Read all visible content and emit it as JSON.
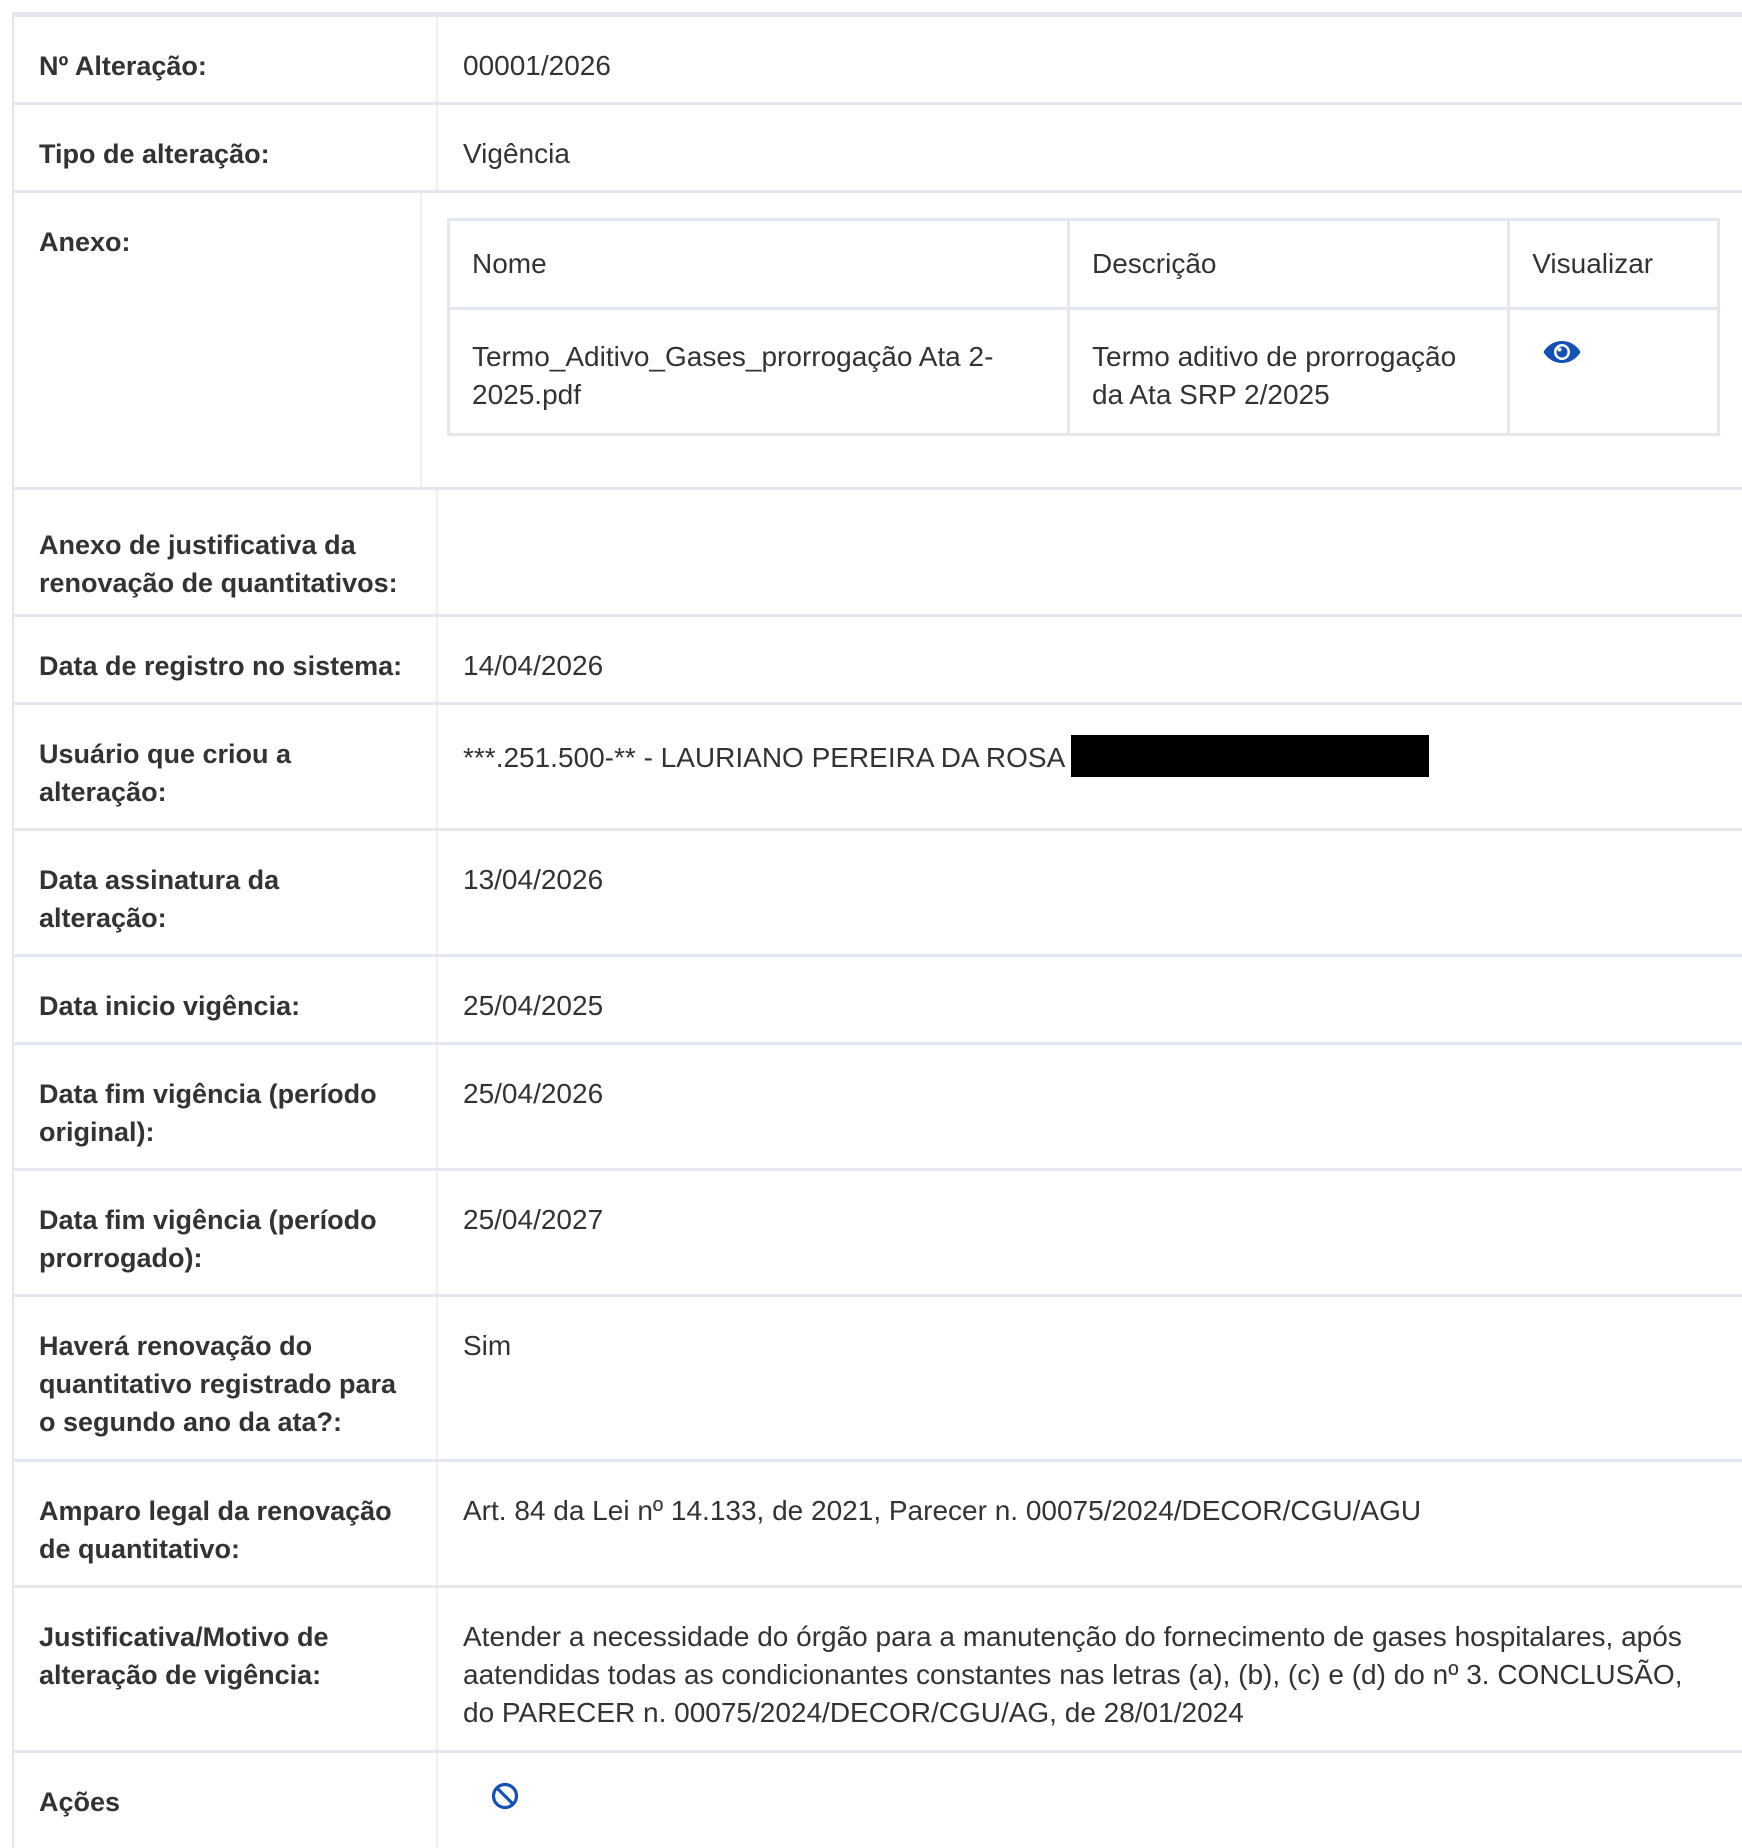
{
  "fields": {
    "numero_alteracao": {
      "label": "Nº Alteração:",
      "value": "00001/2026"
    },
    "tipo_alteracao": {
      "label": "Tipo de alteração:",
      "value": "Vigência"
    },
    "anexo": {
      "label": "Anexo:",
      "columns": [
        "Nome",
        "Descrição",
        "Visualizar"
      ],
      "rows": [
        {
          "nome": "Termo_Aditivo_Gases_prorrogação Ata 2-2025.pdf",
          "descricao": "Termo aditivo de prorrogação da Ata SRP 2/2025",
          "visualizar_icon": "eye-icon"
        }
      ]
    },
    "anexo_justificativa": {
      "label": "Anexo de justificativa da renovação de quantitativos:",
      "value": ""
    },
    "data_registro": {
      "label": "Data de registro no sistema:",
      "value": "14/04/2026"
    },
    "usuario": {
      "label": "Usuário que criou a alteração:",
      "value": "***.251.500-** - LAURIANO PEREIRA DA ROSA"
    },
    "data_assinatura": {
      "label": "Data assinatura da alteração:",
      "value": "13/04/2026"
    },
    "data_inicio_vigencia": {
      "label": "Data inicio vigência:",
      "value": "25/04/2025"
    },
    "data_fim_original": {
      "label": "Data fim vigência (período original):",
      "value": "25/04/2026"
    },
    "data_fim_prorrogado": {
      "label": "Data fim vigência (período prorrogado):",
      "value": "25/04/2027"
    },
    "renovacao_quantitativo": {
      "label": "Haverá renovação do quantitativo registrado para o segundo ano da ata?:",
      "value": "Sim"
    },
    "amparo_legal": {
      "label": "Amparo legal da renovação de quantitativo:",
      "value": "Art. 84 da Lei nº 14.133, de 2021, Parecer n. 00075/2024/DECOR/CGU/AGU"
    },
    "justificativa": {
      "label": "Justificativa/Motivo de alteração de vigência:",
      "value": "Atender a necessidade do órgão para a manutenção do fornecimento de gases hospitalares, após aatendidas todas as condicionantes constantes nas letras (a), (b), (c) e (d) do nº 3. CONCLUSÃO, do PARECER n. 00075/2024/DECOR/CGU/AG, de 28/01/2024"
    },
    "acoes": {
      "label": "Ações",
      "icon": "ban-icon"
    }
  },
  "colors": {
    "icon_blue": "#1351b4",
    "border": "#e4e7ee",
    "text": "#333333",
    "redaction": "#000000"
  }
}
